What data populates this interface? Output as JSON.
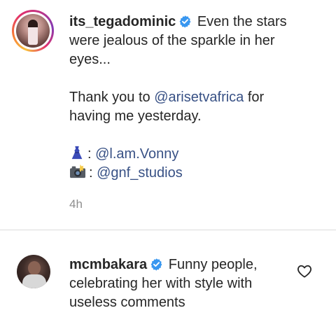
{
  "caption": {
    "username": "its_tegadominic",
    "line1": "Even the stars",
    "line2": "were jealous of the sparkle in her",
    "line3": "eyes...",
    "thanks_prefix": "Thank you to ",
    "thanks_mention": "@arisetvafrica",
    "thanks_suffix": " for",
    "thanks_line2": "having me yesterday.",
    "credit_dress_sep": ": ",
    "credit_dress_mention": "@l.am.Vonny",
    "credit_photo_sep": ": ",
    "credit_photo_mention": "@gnf_studios",
    "timestamp": "4h",
    "verified_icon": "verified-badge-icon",
    "dress_icon": "dress-emoji-icon",
    "camera_icon": "camera-flash-emoji-icon"
  },
  "comment": {
    "username": "mcmbakara",
    "line1": "Funny people,",
    "line2": "celebrating her with style with",
    "line3": "useless comments",
    "like_icon": "heart-icon"
  },
  "colors": {
    "verified": "#3897f0",
    "mention": "#385185",
    "text": "#262626",
    "muted": "#8e8e8e"
  }
}
